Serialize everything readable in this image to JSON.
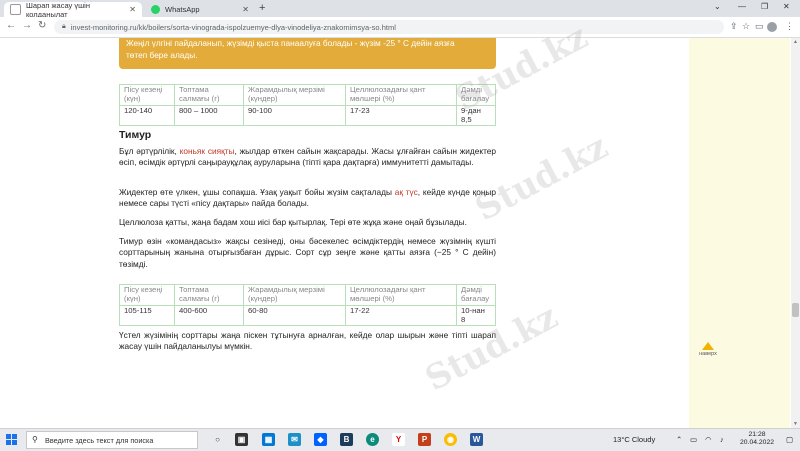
{
  "tabs": [
    {
      "label": "Шарап жасау үшін қолданылат",
      "active": true
    },
    {
      "label": "WhatsApp",
      "active": false
    }
  ],
  "address": {
    "url": "invest-monitoring.ru/kk/boilers/sorta-vinograda-ispolzuemye-dlya-vinodeliya-znakomimsya-so.html"
  },
  "callout": {
    "line1": "Жеңіл үлгіні пайдаланып, жүзімді қыста панаалуға болады - жүзім -25 ° С дейін аязға",
    "line2": "төтеп бере алады."
  },
  "table1": {
    "headers": [
      "Пісу кезеңі (күн)",
      "Топтама салмағы (г)",
      "Жарамдылық мерзімі (күндер)",
      "Целлюлозадағы қант мөлшері (%)",
      "Дәмді бағалау"
    ],
    "values": [
      "120-140",
      "800 – 1000",
      "90-100",
      "17-23",
      "9-дан 8,5"
    ]
  },
  "section_title": "Тимур",
  "para1": {
    "pre": "Бұл әртүрлілік, ",
    "link": "коньяк сияқты",
    "post": ", жылдар өткен сайын жақсарады. Жасы ұлғайған сайын жидектер өсіп, өсімдік әртүрлі саңырауқұлақ ауруларына (тіпті қара дақтарға) иммунитетті дамытады."
  },
  "para2": {
    "pre": "Жидектер өте үлкен, ұшы сопақша. Ұзақ уақыт бойы жүзім сақталады ",
    "link": "ақ түс",
    "post": ", кейде күнде қоңыр немесе сары түсті «пісу дақтары» пайда болады."
  },
  "para3": "Целлюлоза қатты, жаңа бадам хош иісі бар қытырлақ. Тері өте жұқа және оңай бұзылады.",
  "para4": "Тимур өзін «командасыз» жақсы сезінеді, оны бәсекелес өсімдіктердің немесе жүзімнің күшті сорттарының жанына отырғызбаған дұрыс. Сорт сұр зеңге және қатты аязға (−25 ° С дейін) төзімді.",
  "table2": {
    "headers": [
      "Пісу кезеңі (күн)",
      "Топтама салмағы (г)",
      "Жарамдылық мерзімі (күндер)",
      "Целлюлозадағы қант мөлшері (%)",
      "Дәмді бағалау"
    ],
    "values": [
      "105-115",
      "400-600",
      "60-80",
      "17-22",
      "10-нан 8"
    ]
  },
  "para5": "Үстел жүзімінің сорттары жаңа піскен тұтынуға арналған, кейде олар шырын және тіпті шарап жасау үшін пайдаланылуы мүмкін.",
  "up_button": "наверх",
  "watermark": "Stud.kz",
  "taskbar": {
    "search_placeholder": "Введите здесь текст для поиска",
    "weather": "13°C  Cloudy",
    "time": "21:28",
    "date": "20.04.2022"
  },
  "colors": {
    "callout": "#e3ac3a",
    "link": "#c0392b",
    "side": "#fdfae2",
    "table_border": "#b8e0b8"
  }
}
